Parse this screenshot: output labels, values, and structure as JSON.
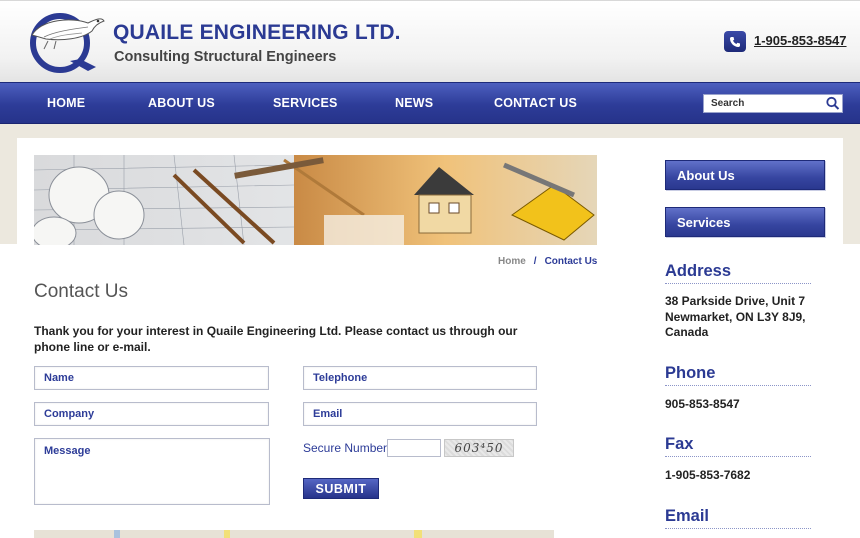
{
  "header": {
    "company_name": "QUAILE ENGINEERING LTD.",
    "tagline": "Consulting Structural Engineers",
    "phone": "1-905-853-8547",
    "logo_icon": "quail-q-logo-icon",
    "phone_icon": "phone-icon"
  },
  "nav": {
    "items": [
      {
        "label": "HOME"
      },
      {
        "label": "ABOUT US"
      },
      {
        "label": "SERVICES"
      },
      {
        "label": "NEWS"
      },
      {
        "label": "CONTACT US"
      }
    ],
    "search": {
      "placeholder": "Search",
      "icon": "search-icon"
    }
  },
  "banner": {
    "icon": "construction-banner-image"
  },
  "breadcrumb": {
    "home": "Home",
    "separator": "/",
    "current": "Contact Us"
  },
  "main": {
    "title": "Contact Us",
    "intro": "Thank you for your interest in Quaile Engineering Ltd. Please contact us through our phone line or e-mail."
  },
  "form": {
    "name_placeholder": "Name",
    "telephone_placeholder": "Telephone",
    "company_placeholder": "Company",
    "email_placeholder": "Email",
    "message_placeholder": "Message",
    "secure_label": "Secure Number:",
    "captcha_text": "603⁴50",
    "submit_label": "SUBMIT"
  },
  "sidebar": {
    "buttons": [
      {
        "label": "About Us"
      },
      {
        "label": "Services"
      }
    ],
    "address_heading": "Address",
    "address_line1": "38 Parkside Drive, Unit 7",
    "address_line2": "Newmarket, ON L3Y 8J9,",
    "address_line3": "Canada",
    "phone_heading": "Phone",
    "phone": "905-853-8547",
    "fax_heading": "Fax",
    "fax": "1-905-853-7682",
    "email_heading": "Email"
  },
  "colors": {
    "brand": "#2b3a93",
    "nav": "#2d3c98",
    "background": "#ece8de"
  }
}
